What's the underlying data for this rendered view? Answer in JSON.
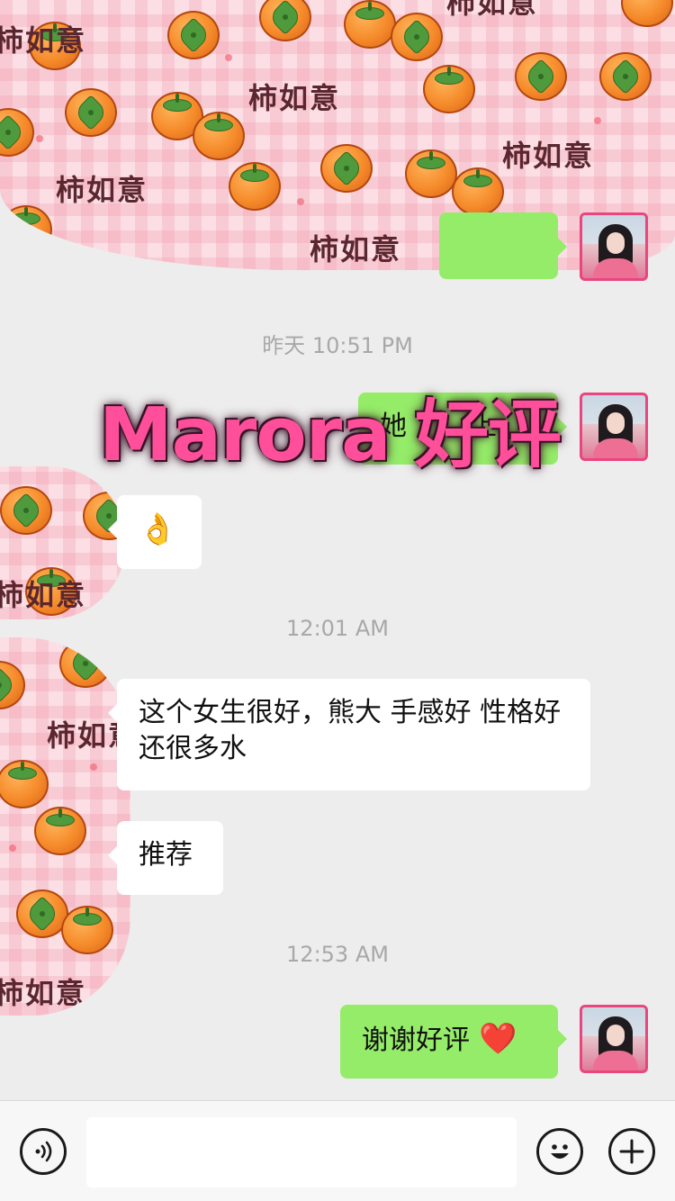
{
  "sticker_text": "柿如意",
  "timestamps": {
    "t1": "昨天 10:51 PM",
    "t2": "12:01 AM",
    "t3": "12:53 AM"
  },
  "messages": {
    "m1_partial": "她",
    "m1_tail": "上",
    "m2_emoji": "👌",
    "m3": "这个女生很好，熊大 手感好  性格好 还很多水",
    "m4": "推荐",
    "m5": "谢谢好评",
    "m5_emoji": "❤️"
  },
  "watermark": "Marora 好评",
  "input": {
    "placeholder": ""
  },
  "colors": {
    "background": "#ededed",
    "outgoing_bubble": "#95ec69",
    "incoming_bubble": "#ffffff",
    "watermark": "#ff4f9a",
    "avatar_border": "#e9467f"
  },
  "icons": [
    "voice-icon",
    "emoji-icon",
    "plus-icon"
  ]
}
